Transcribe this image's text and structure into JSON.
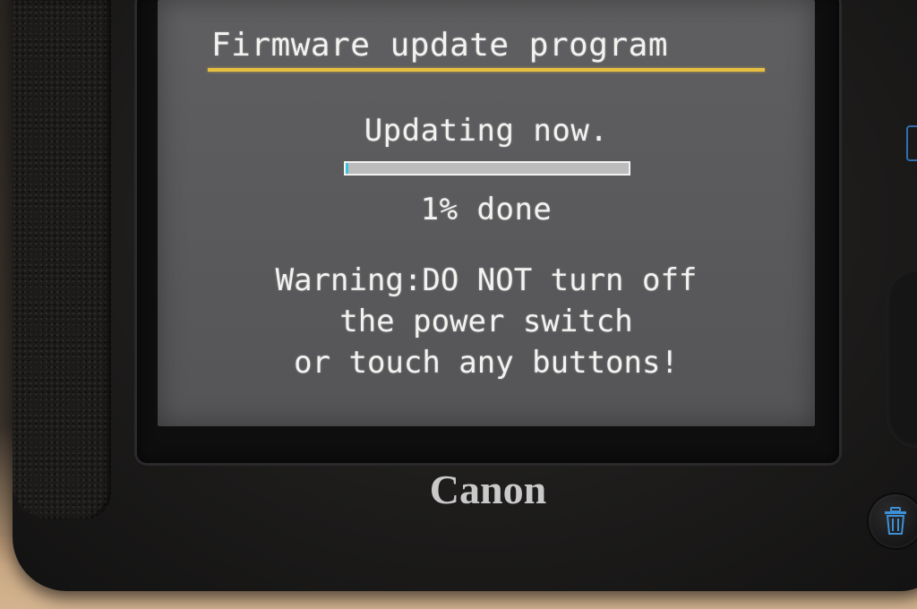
{
  "screen": {
    "title": "Firmware update program",
    "status": "Updating now.",
    "progress_percent": 1,
    "percent_label": "1% done",
    "warning_lines": [
      "Warning:DO NOT turn off",
      "the power switch",
      "or touch any buttons!"
    ]
  },
  "body": {
    "brand": "Canon"
  },
  "colors": {
    "title_underline": "#e8c040",
    "progress_fill": "#3fc2d8",
    "lcd_background": "#5a5a5c",
    "trash_icon": "#3d8fd6"
  },
  "icons": {
    "trash": "trash-icon"
  }
}
